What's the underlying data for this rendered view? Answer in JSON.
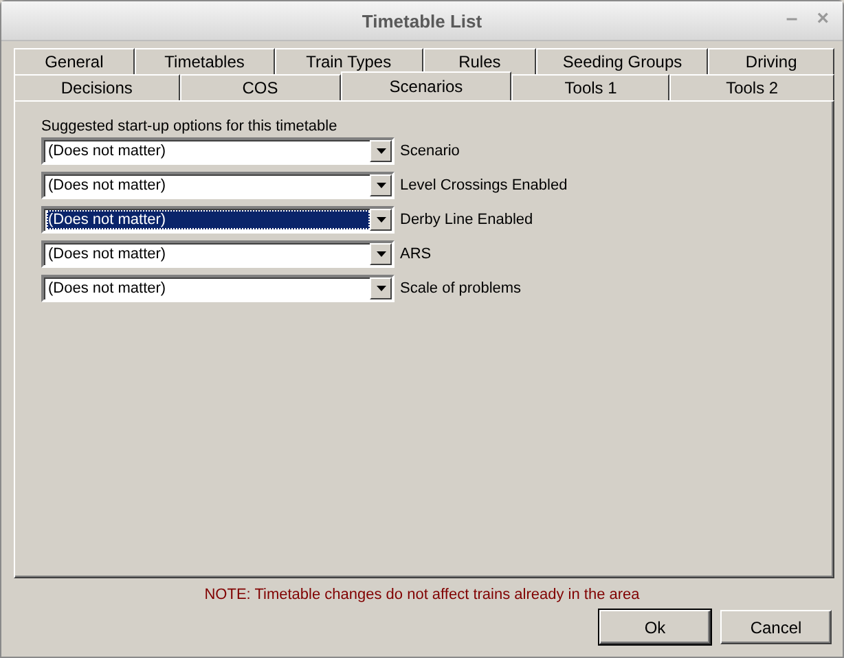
{
  "window": {
    "title": "Timetable List",
    "controls": [
      "–",
      "×"
    ]
  },
  "tab_rows": [
    [
      {
        "label": "General",
        "selected": false
      },
      {
        "label": "Timetables",
        "selected": false
      },
      {
        "label": "Train Types",
        "selected": false
      },
      {
        "label": "Rules",
        "selected": false
      },
      {
        "label": "Seeding Groups",
        "selected": false
      },
      {
        "label": "Driving",
        "selected": false
      }
    ],
    [
      {
        "label": "Decisions",
        "selected": false
      },
      {
        "label": "COS",
        "selected": false
      },
      {
        "label": "Scenarios",
        "selected": true
      },
      {
        "label": "Tools 1",
        "selected": false
      },
      {
        "label": "Tools 2",
        "selected": false
      }
    ]
  ],
  "panel": {
    "heading": "Suggested start-up options for this timetable",
    "options": [
      {
        "value": "(Does not matter)",
        "label": "Scenario",
        "focused": false
      },
      {
        "value": "(Does not matter)",
        "label": "Level Crossings Enabled",
        "focused": false
      },
      {
        "value": "(Does not matter)",
        "label": "Derby Line Enabled",
        "focused": true
      },
      {
        "value": "(Does not matter)",
        "label": "ARS",
        "focused": false
      },
      {
        "value": "(Does not matter)",
        "label": "Scale of problems",
        "focused": false
      }
    ]
  },
  "note": "NOTE: Timetable changes do not affect trains already in the area",
  "buttons": [
    {
      "label": "Ok",
      "kind": "default"
    },
    {
      "label": "Cancel",
      "kind": "normal"
    }
  ]
}
